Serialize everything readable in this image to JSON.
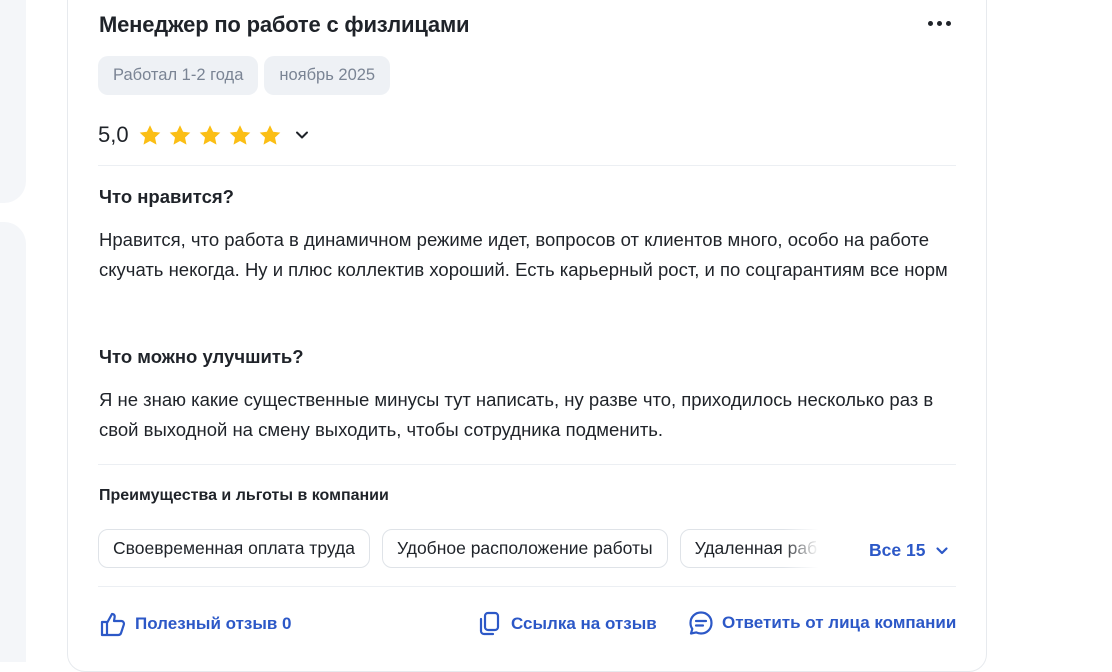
{
  "review": {
    "title": "Менеджер по работе с физлицами",
    "tags": [
      "Работал 1-2 года",
      "ноябрь 2025"
    ],
    "rating": {
      "value": "5,0",
      "stars": 5,
      "max_stars": 5,
      "star_color": "#fbbe14"
    },
    "likes_heading": "Что нравится?",
    "likes_text": "Нравится, что работа в динамичном режиме идет, вопросов от клиентов много, особо на работе скучать некогда. Ну и плюс коллектив хороший. Есть карьерный рост, и по соцгарантиям все норм",
    "improve_heading": "Что можно улучшить?",
    "improve_text": "Я не знаю какие существенные минусы тут написать, ну разве что, приходилось несколько раз в свой выходной на смену выходить, чтобы сотрудника подменить."
  },
  "benefits": {
    "title": "Преимущества и льготы в компании",
    "items": [
      "Своевременная оплата труда",
      "Удобное расположение работы",
      "Удаленная раб"
    ],
    "all_label": "Все 15"
  },
  "actions": {
    "helpful_label": "Полезный отзыв 0",
    "link_label": "Ссылка на отзыв",
    "reply_label": "Ответить от лица компании"
  },
  "icons": {
    "more": "more-dots-icon",
    "rating_toggle": "chevron-down-icon",
    "helpful": "thumbs-up-icon",
    "link": "copy-icon",
    "reply": "chat-bubble-icon"
  },
  "colors": {
    "accent": "#2c58c7",
    "star": "#fbbe14",
    "tag_bg": "#eef1f5",
    "tag_text": "#7a8494"
  }
}
